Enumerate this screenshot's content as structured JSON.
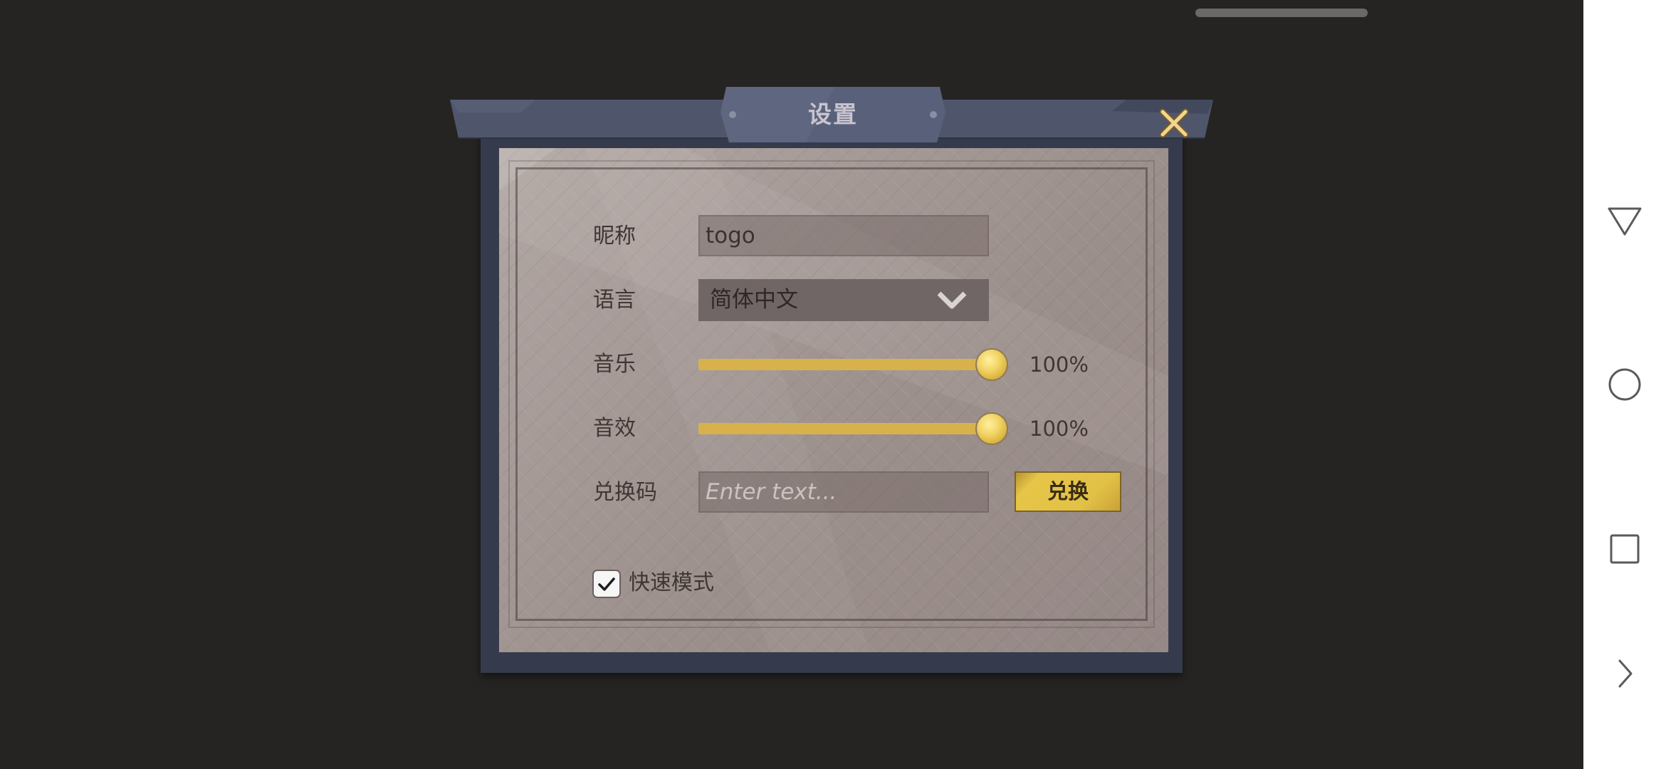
{
  "dialog": {
    "title": "设置",
    "close_icon": "close-x-icon"
  },
  "form": {
    "nickname": {
      "label": "昵称",
      "value": "togo"
    },
    "language": {
      "label": "语言",
      "value": "简体中文",
      "icon": "chevron-down-icon"
    },
    "music": {
      "label": "音乐",
      "value_text": "100%",
      "level": 1.0
    },
    "sound_effects": {
      "label": "音效",
      "value_text": "100%",
      "level": 1.0
    },
    "redeem_code": {
      "label": "兑换码",
      "placeholder": "Enter text...",
      "value": "",
      "button_label": "兑换"
    },
    "fast_mode": {
      "label": "快速模式",
      "checked": true
    }
  },
  "system_nav": {
    "back_icon": "triangle-back-icon",
    "home_icon": "circle-home-icon",
    "recents_icon": "square-recents-icon",
    "expand_icon": "chevron-right-icon"
  },
  "colors": {
    "background": "#252422",
    "frame": "#353b4c",
    "header": "#4f566c",
    "accent_gold": "#d7b24c",
    "paper": "#a49895"
  }
}
